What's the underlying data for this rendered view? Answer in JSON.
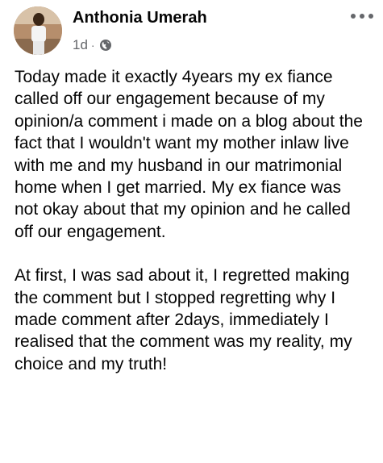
{
  "post": {
    "author": "Anthonia Umerah",
    "time": "1d",
    "separator": "·",
    "privacy_icon": "globe-icon",
    "more_icon": "more-options-icon",
    "paragraphs": [
      "Today made it exactly 4years my ex fiance called off our engagement because of my opinion/a comment i made on a blog about the fact that I wouldn't want my mother inlaw live with me and my husband in our matrimonial home when I get married. My ex fiance was not okay about that my opinion and he called off our engagement.",
      "At first, I was sad about it, I regretted making the comment but I stopped regretting why I made comment after 2days, immediately I realised that the comment was my reality, my choice and my truth!"
    ]
  },
  "colors": {
    "text": "#050505",
    "secondary_text": "#65676b",
    "background": "#ffffff"
  }
}
